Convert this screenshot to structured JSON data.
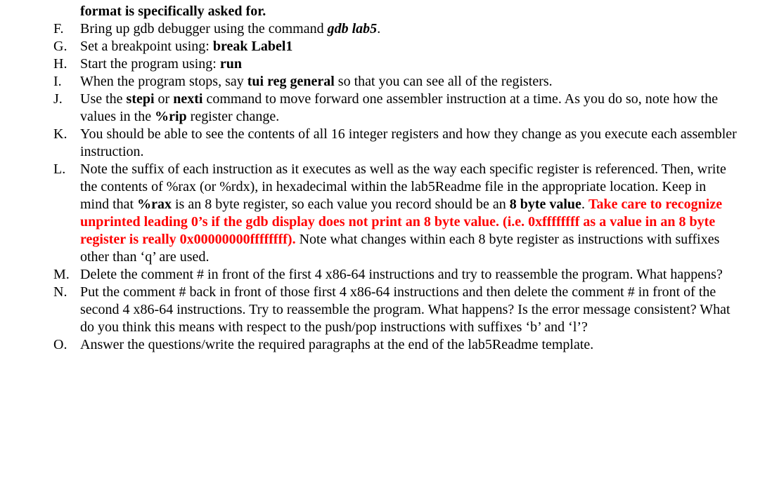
{
  "top_line": "format is specifically asked for.",
  "items": {
    "F": {
      "marker": "F.",
      "pre": "Bring up gdb debugger using the command ",
      "cmd": "gdb lab5",
      "post": "."
    },
    "G": {
      "marker": "G.",
      "pre": "Set a breakpoint using:  ",
      "cmd": "break Label1"
    },
    "H": {
      "marker": "H.",
      "pre": "Start the program using: ",
      "cmd": "run"
    },
    "I": {
      "marker": "I.",
      "pre": "When the program stops, say ",
      "cmd": "tui reg general",
      "post": " so that you can see all of the registers."
    },
    "J": {
      "marker": "J.",
      "pre": "Use the ",
      "cmd1": "stepi",
      "mid1": " or ",
      "cmd2": "nexti",
      "mid2": "  command to move forward one assembler instruction at a time. As you do so, note how the values in the ",
      "cmd3": "%rip",
      "post": " register change."
    },
    "K": {
      "marker": "K.",
      "text": "You should be able to see the contents of all 16 integer registers and how they change as you execute each assembler instruction."
    },
    "L": {
      "marker": "L.",
      "p1": "Note the suffix of each instruction as it executes as well as the way each specific register is referenced. Then, write the contents of %rax (or %rdx), in hexadecimal within the lab5Readme file in the appropriate location.  Keep in mind that ",
      "b1": "%rax",
      "p2": " is an 8 byte register, so each value you record should be an ",
      "b2": "8 byte value",
      "p3": ". ",
      "red": "Take care to recognize unprinted leading 0’s if the gdb display does not print an 8 byte value.  (i.e. 0xffffffff as a value in an 8 byte register is really 0x00000000ffffffff).",
      "p4": " Note what changes within each 8 byte register as instructions with suffixes other than ‘q’ are used."
    },
    "M": {
      "marker": "M.",
      "text": "Delete the comment # in front of the first 4 x86-64 instructions and try to reassemble the program.  What happens?"
    },
    "N": {
      "marker": "N.",
      "text": "Put the comment # back in front of those first 4 x86-64 instructions and then delete the comment # in front of the second 4 x86-64 instructions.  Try to reassemble the program.  What happens?  Is the error message consistent? What do you think this means with respect to the push/pop instructions with suffixes ‘b’ and ‘l’?"
    },
    "O": {
      "marker": "O.",
      "text": "Answer the questions/write the required paragraphs at the end of the lab5Readme template."
    }
  }
}
